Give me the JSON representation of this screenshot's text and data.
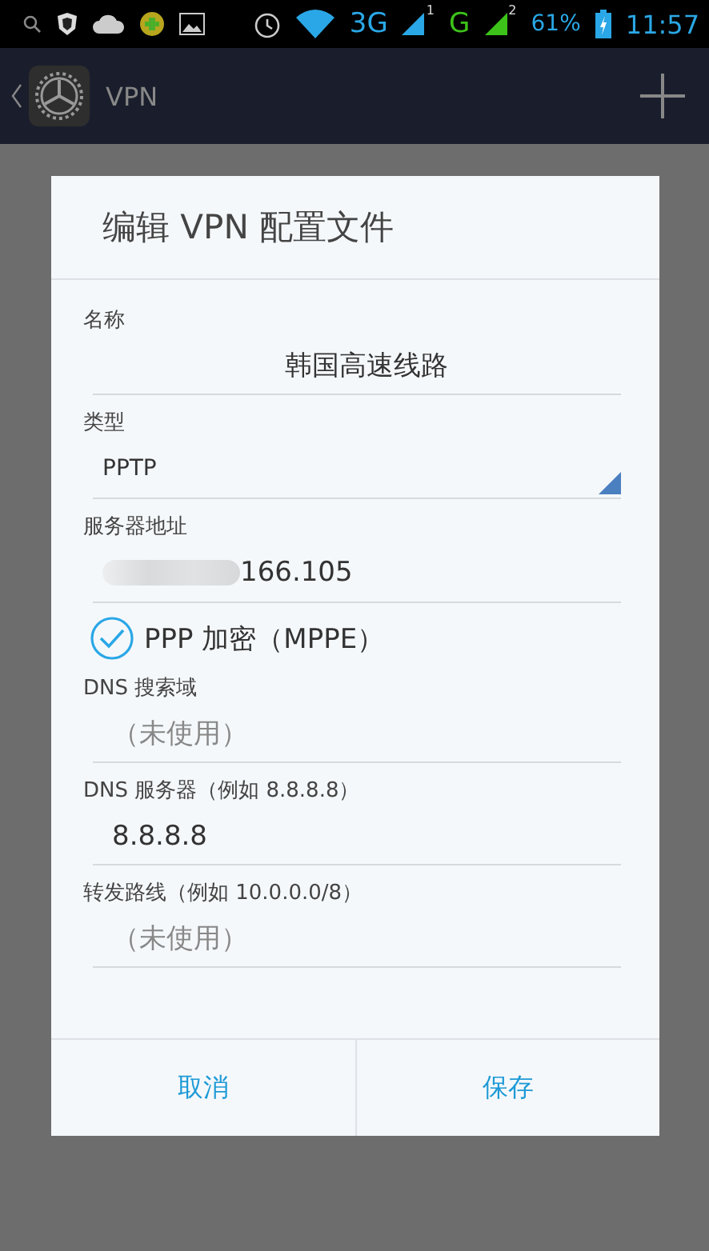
{
  "status_bar": {
    "network_3g": "3G",
    "sim1_index": "1",
    "network_g": "G",
    "sim2_index": "2",
    "battery": "61%",
    "time": "11:57"
  },
  "app_bar": {
    "title": "VPN"
  },
  "dialog": {
    "title": "编辑 VPN 配置文件",
    "fields": [
      {
        "kind": "text",
        "label": "名称",
        "value": "韩国高速线路",
        "centered": true
      },
      {
        "kind": "dropdown",
        "label": "类型",
        "value": "PPTP"
      },
      {
        "kind": "text",
        "label": "服务器地址",
        "value": "166.105",
        "redacted": true
      },
      {
        "kind": "checkbox",
        "label": "PPP 加密（MPPE）",
        "checked": true
      },
      {
        "kind": "text",
        "label": "DNS 搜索域",
        "placeholder": "（未使用）"
      },
      {
        "kind": "text",
        "label": "DNS 服务器（例如 8.8.8.8）",
        "value": "8.8.8.8"
      },
      {
        "kind": "text",
        "label": "转发路线（例如 10.0.0.0/8）",
        "placeholder": "（未使用）"
      }
    ],
    "buttons": [
      "取消",
      "保存"
    ]
  }
}
